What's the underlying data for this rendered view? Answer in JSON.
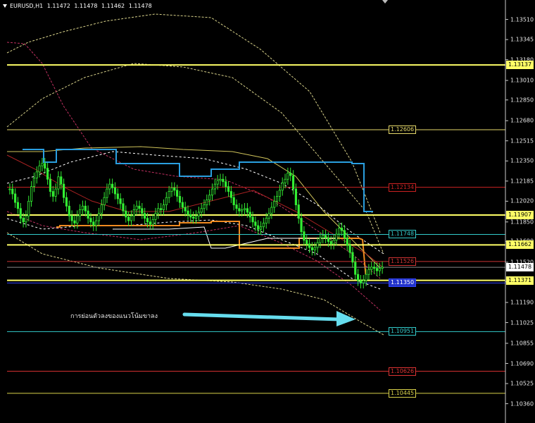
{
  "header": {
    "symbol": "EURUSD,H1",
    "open": "1.11472",
    "high": "1.11478",
    "low": "1.11462",
    "close": "1.11478"
  },
  "annotation": "การย่อนตัวลงของแนวโน้มขาลง",
  "axis": {
    "min": 1.103,
    "max": 1.136,
    "labels": [
      "1.13510",
      "1.13345",
      "1.13180",
      "1.13010",
      "1.12850",
      "1.12680",
      "1.12515",
      "1.12350",
      "1.12185",
      "1.12020",
      "1.11850",
      "1.11690",
      "1.11520",
      "1.11360",
      "1.11190",
      "1.11025",
      "1.10855",
      "1.10690",
      "1.10525",
      "1.10360"
    ]
  },
  "levels": [
    {
      "value": "1.13137",
      "color": "#ffff66",
      "width": 2,
      "tag": "axis"
    },
    {
      "value": "1.12606",
      "color": "#e6d96a",
      "width": 1,
      "tag": "inner"
    },
    {
      "value": "1.12134",
      "color": "#cc2222",
      "width": 1,
      "tag": "inner"
    },
    {
      "value": "1.11907",
      "color": "#ffff66",
      "width": 2,
      "tag": "axis"
    },
    {
      "value": "1.11748",
      "color": "#33cccc",
      "width": 1,
      "tag": "inner"
    },
    {
      "value": "1.11662",
      "color": "#ffff66",
      "width": 2,
      "tag": "axis"
    },
    {
      "value": "1.11526",
      "color": "#cc3333",
      "width": 1,
      "tag": "inner"
    },
    {
      "value": "1.11371",
      "color": "#ffff66",
      "width": 2,
      "tag": "axis"
    },
    {
      "value": "1.11350",
      "color": "#3344ff",
      "width": 1,
      "tag": "inner"
    },
    {
      "value": "1.10951",
      "color": "#33cccc",
      "width": 1,
      "tag": "inner"
    },
    {
      "value": "1.10626",
      "color": "#dd3333",
      "width": 1,
      "tag": "inner"
    },
    {
      "value": "1.10445",
      "color": "#d9d24a",
      "width": 1,
      "tag": "inner"
    }
  ],
  "current_price": "1.11478",
  "chart_data": {
    "type": "candlestick",
    "title": "EURUSD,H1",
    "ylim": [
      1.103,
      1.136
    ],
    "closes": [
      1.1212,
      1.1208,
      1.1201,
      1.1196,
      1.1188,
      1.1185,
      1.119,
      1.1202,
      1.1214,
      1.1221,
      1.1226,
      1.1231,
      1.1233,
      1.1229,
      1.122,
      1.121,
      1.1206,
      1.1212,
      1.1222,
      1.1216,
      1.1205,
      1.1198,
      1.119,
      1.1186,
      1.1184,
      1.119,
      1.1195,
      1.1198,
      1.1194,
      1.1188,
      1.1185,
      1.1182,
      1.1186,
      1.1192,
      1.1199,
      1.1205,
      1.1212,
      1.1216,
      1.1213,
      1.1208,
      1.1204,
      1.12,
      1.1194,
      1.1189,
      1.1186,
      1.119,
      1.1195,
      1.1198,
      1.1196,
      1.1192,
      1.1188,
      1.1185,
      1.1183,
      1.1187,
      1.1192,
      1.1196,
      1.1195,
      1.1199,
      1.1205,
      1.121,
      1.1213,
      1.1211,
      1.1206,
      1.1201,
      1.1197,
      1.1194,
      1.1191,
      1.1189,
      1.1188,
      1.119,
      1.1193,
      1.1196,
      1.1199,
      1.1203,
      1.1207,
      1.1212,
      1.1216,
      1.1219,
      1.122,
      1.1218,
      1.1214,
      1.121,
      1.1205,
      1.1199,
      1.1196,
      1.1194,
      1.1195,
      1.1196,
      1.1193,
      1.1189,
      1.1185,
      1.1182,
      1.1179,
      1.1181,
      1.1184,
      1.1188,
      1.1192,
      1.1197,
      1.1202,
      1.1206,
      1.1211,
      1.1217,
      1.122,
      1.1225,
      1.1223,
      1.1212,
      1.1199,
      1.1188,
      1.1177,
      1.117,
      1.1167,
      1.1164,
      1.1162,
      1.1164,
      1.1168,
      1.1172,
      1.1174,
      1.1172,
      1.1169,
      1.1167,
      1.117,
      1.1175,
      1.118,
      1.1178,
      1.1172,
      1.1166,
      1.116,
      1.1152,
      1.1142,
      1.1137,
      1.1135,
      1.1137,
      1.1142,
      1.1146,
      1.1148,
      1.1147,
      1.1145,
      1.1147,
      1.1148
    ]
  }
}
